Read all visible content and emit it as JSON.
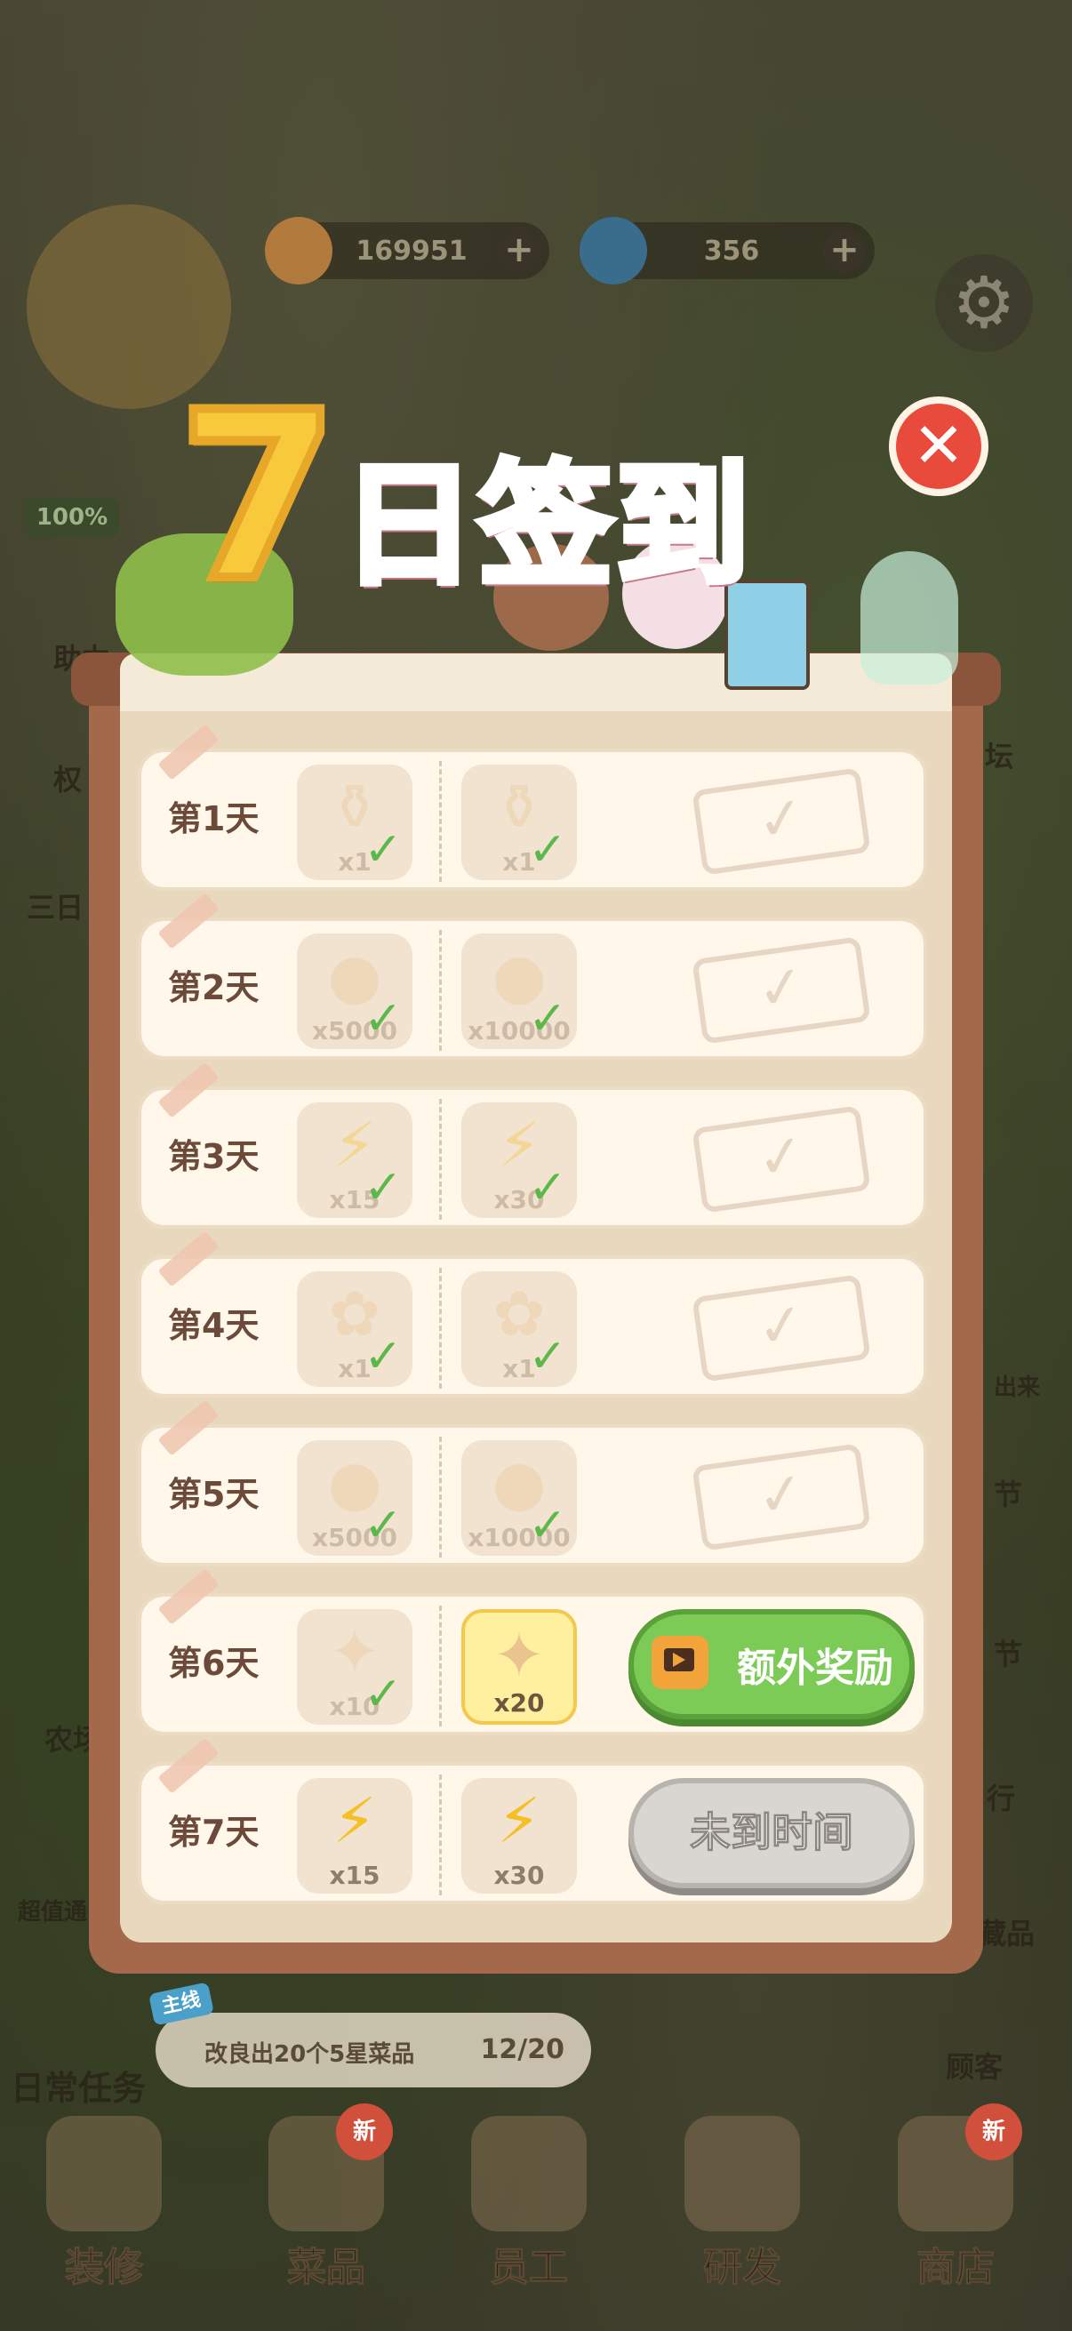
{
  "hud": {
    "coins": "169951",
    "gems": "356",
    "progress_pct": "100%"
  },
  "side_left": [
    "助力",
    "权",
    "三日",
    "农场",
    "超值通"
  ],
  "side_right": [
    "坛",
    "出来",
    "节",
    "节",
    "行",
    "藏品",
    "顾客"
  ],
  "title": {
    "number": "7",
    "text": "日签到"
  },
  "rows": [
    {
      "day": "第1天",
      "rewards": [
        {
          "icon": "jar-icon",
          "qty": "x1",
          "claimed": true
        },
        {
          "icon": "jar-icon",
          "qty": "x1",
          "claimed": true
        }
      ],
      "state": "stamped"
    },
    {
      "day": "第2天",
      "rewards": [
        {
          "icon": "coin-bag-icon",
          "qty": "x5000",
          "claimed": true
        },
        {
          "icon": "coin-bag-icon",
          "qty": "x10000",
          "claimed": true
        }
      ],
      "state": "stamped"
    },
    {
      "day": "第3天",
      "rewards": [
        {
          "icon": "lightning-icon",
          "qty": "x15",
          "claimed": true
        },
        {
          "icon": "lightning-icon",
          "qty": "x30",
          "claimed": true
        }
      ],
      "state": "stamped"
    },
    {
      "day": "第4天",
      "rewards": [
        {
          "icon": "seed-bag-icon",
          "qty": "x1",
          "claimed": true
        },
        {
          "icon": "seed-bag-icon",
          "qty": "x1",
          "claimed": true
        }
      ],
      "state": "stamped"
    },
    {
      "day": "第5天",
      "rewards": [
        {
          "icon": "coin-bag-icon",
          "qty": "x5000",
          "claimed": true
        },
        {
          "icon": "coin-bag-icon",
          "qty": "x10000",
          "claimed": true
        }
      ],
      "state": "stamped"
    },
    {
      "day": "第6天",
      "rewards": [
        {
          "icon": "gem-bag-icon",
          "qty": "x10",
          "claimed": true
        },
        {
          "icon": "gem-bag-icon",
          "qty": "x20",
          "claimed": false
        }
      ],
      "state": "extra",
      "button": "额外奖励"
    },
    {
      "day": "第7天",
      "rewards": [
        {
          "icon": "lightning-icon",
          "qty": "x15",
          "claimed": false
        },
        {
          "icon": "lightning-icon",
          "qty": "x30",
          "claimed": false
        }
      ],
      "state": "locked",
      "button": "未到时间"
    }
  ],
  "quest": {
    "tag": "主线",
    "text": "改良出20个5星菜品",
    "count": "12/20"
  },
  "quest_label": "日常任务",
  "nav": [
    {
      "label": "装修",
      "badge": ""
    },
    {
      "label": "菜品",
      "badge": "新"
    },
    {
      "label": "员工",
      "badge": ""
    },
    {
      "label": "研发",
      "badge": ""
    },
    {
      "label": "商店",
      "badge": "新"
    }
  ]
}
